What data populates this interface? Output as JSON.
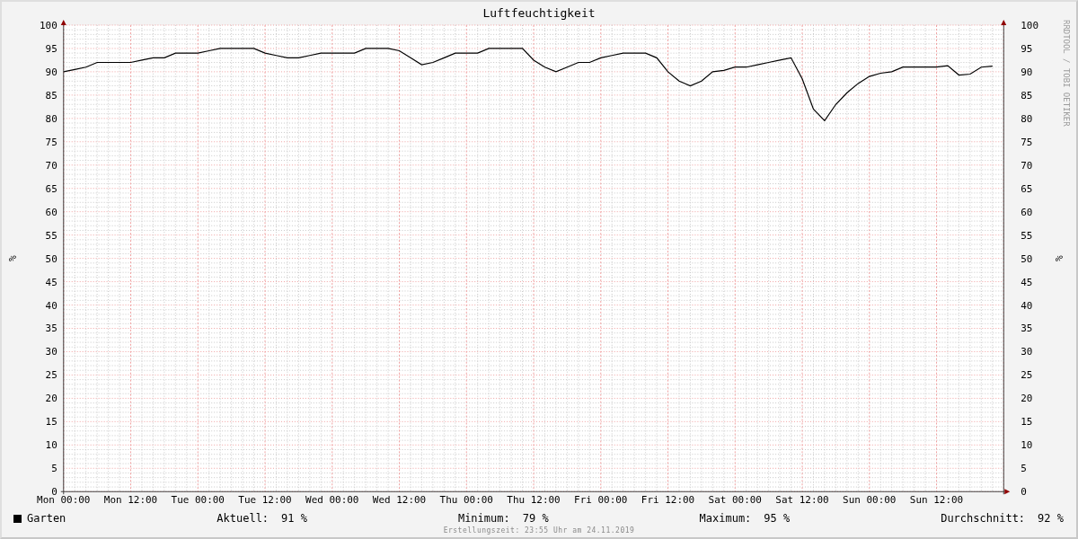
{
  "chart_data": {
    "type": "line",
    "title": "Luftfeuchtigkeit",
    "ylabel": "%",
    "grid": true,
    "ylim": [
      0,
      100
    ],
    "categories": [
      "Mon 00:00",
      null,
      null,
      null,
      null,
      null,
      "Mon 12:00",
      null,
      null,
      null,
      null,
      null,
      "Tue 00:00",
      null,
      null,
      null,
      null,
      null,
      "Tue 12:00",
      null,
      null,
      null,
      null,
      null,
      "Wed 00:00",
      null,
      null,
      null,
      null,
      null,
      "Wed 12:00",
      null,
      null,
      null,
      null,
      null,
      "Thu 00:00",
      null,
      null,
      null,
      null,
      null,
      "Thu 12:00",
      null,
      null,
      null,
      null,
      null,
      "Fri 00:00",
      null,
      null,
      null,
      null,
      null,
      "Fri 12:00",
      null,
      null,
      null,
      null,
      null,
      "Sat 00:00",
      null,
      null,
      null,
      null,
      null,
      "Sat 12:00",
      null,
      null,
      null,
      null,
      null,
      "Sun 00:00",
      null,
      null,
      null,
      null,
      null,
      "Sun 12:00",
      null,
      null,
      null,
      null,
      null
    ],
    "yticks": [
      0,
      5,
      10,
      15,
      20,
      25,
      30,
      35,
      40,
      45,
      50,
      55,
      60,
      65,
      70,
      75,
      80,
      85,
      90,
      95,
      100
    ],
    "series": [
      {
        "name": "Garten",
        "color": "#000000",
        "values": [
          90,
          90.5,
          91,
          92,
          92,
          92,
          92,
          92.5,
          93,
          93,
          94,
          94,
          94,
          94.5,
          95,
          95,
          95,
          95,
          94,
          93.5,
          93,
          93,
          93.5,
          94,
          94,
          94,
          94,
          95,
          95,
          95,
          94.5,
          93,
          91.5,
          92,
          93,
          94,
          94,
          94,
          95,
          95,
          95,
          95,
          92.5,
          91,
          90,
          91,
          92,
          92,
          93,
          93.5,
          94,
          94,
          94,
          93,
          90,
          88,
          87,
          88,
          90,
          90.3,
          91,
          91,
          91.5,
          92,
          92.5,
          93,
          88.5,
          82,
          79.5,
          83,
          85.5,
          87.5,
          89,
          89.7,
          90,
          91,
          91,
          91,
          91,
          91.3,
          89.3,
          89.5,
          91,
          91.2
        ]
      }
    ]
  },
  "right_axis": {
    "label": "%",
    "ticks": [
      "100",
      "95",
      "90",
      "85",
      "80",
      "75",
      "70",
      "65",
      "60",
      "55",
      "50",
      "45",
      "40",
      "35",
      "30",
      "25",
      "20",
      "15",
      "10",
      "5",
      "0"
    ]
  },
  "credit": "RRDTOOL / TOBI OETIKER",
  "stats": [
    {
      "label": "Aktuell:",
      "value": "91 %"
    },
    {
      "label": "Minimum:",
      "value": "79 %"
    },
    {
      "label": "Maximum:",
      "value": "95 %"
    },
    {
      "label": "Durchschnitt:",
      "value": "92 %"
    }
  ],
  "footer": "Erstellungszeit: 23:55 Uhr am 24.11.2019"
}
